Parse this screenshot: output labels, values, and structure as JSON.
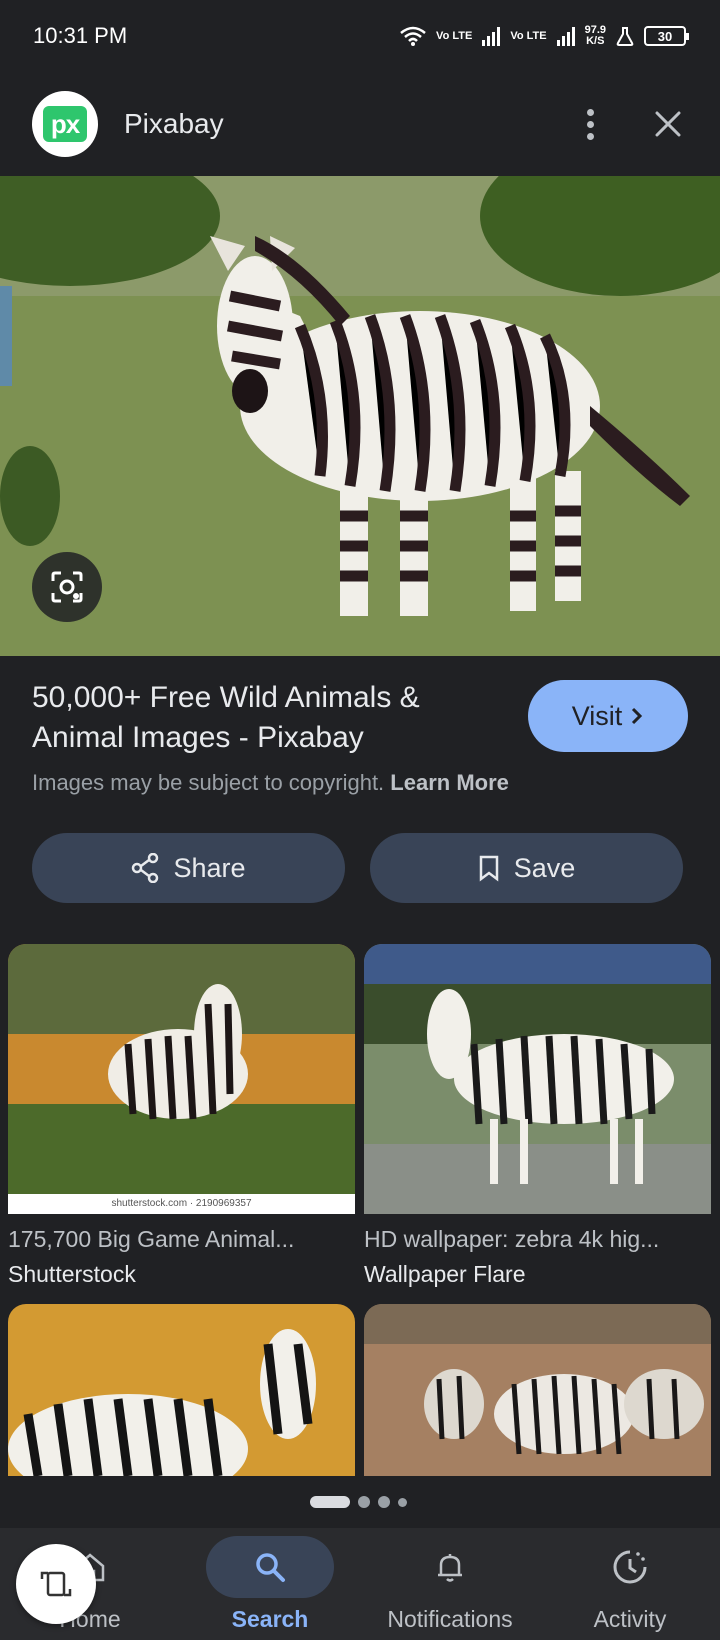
{
  "status_bar": {
    "time": "10:31 PM",
    "volte1": "Vo LTE",
    "volte2": "Vo LTE",
    "speed_value": "97.9",
    "speed_unit": "K/S",
    "battery": "30"
  },
  "header": {
    "logo_text": "px",
    "site_name": "Pixabay"
  },
  "result": {
    "title": "50,000+ Free Wild Animals & Animal Images - Pixabay",
    "visit_label": "Visit",
    "copyright_text": "Images may be subject to copyright.",
    "learn_more": "Learn More",
    "share_label": "Share",
    "save_label": "Save"
  },
  "related": [
    {
      "title": "175,700 Big Game Animal...",
      "source": "Shutterstock",
      "watermark": "shutterstock.com · 2190969357"
    },
    {
      "title": "HD wallpaper: zebra 4k hig...",
      "source": "Wallpaper Flare"
    }
  ],
  "bottom_nav": [
    {
      "label": "Home",
      "icon": "home-icon"
    },
    {
      "label": "Search",
      "icon": "search-icon",
      "active": true
    },
    {
      "label": "Notifications",
      "icon": "bell-icon"
    },
    {
      "label": "Activity",
      "icon": "history-icon"
    }
  ],
  "colors": {
    "background": "#202124",
    "accent": "#8ab4f8",
    "pill": "#394457",
    "pixabay_green": "#2ec66d"
  }
}
